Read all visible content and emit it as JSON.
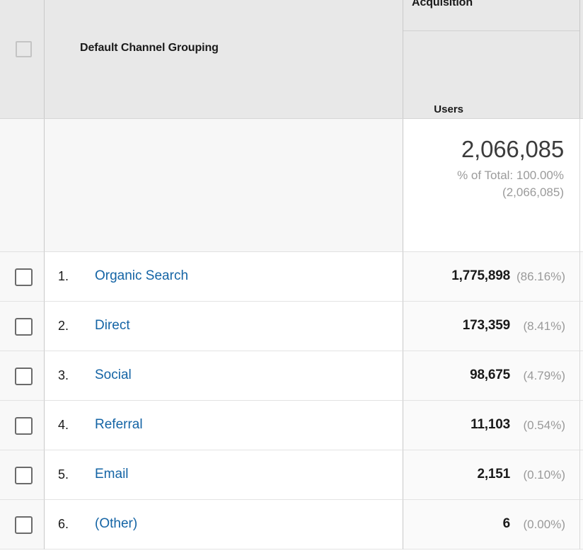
{
  "table": {
    "header": {
      "select_all_checkbox": "",
      "dimension_label": "Default Channel Grouping",
      "group_label": "Acquisition",
      "metric_label": "Users",
      "help_icon_glyph": "?",
      "sort_direction": "descending",
      "sort_arrow_glyph": "↓"
    },
    "summary": {
      "total": "2,066,085",
      "percent_of_total": "% of Total: 100.00%",
      "total_parenthetical": "(2,066,085)"
    },
    "columns": [
      "",
      "Default Channel Grouping",
      "Users"
    ],
    "rows": [
      {
        "index": "1.",
        "channel": "Organic Search",
        "users": "1,775,898",
        "percent": "(86.16%)"
      },
      {
        "index": "2.",
        "channel": "Direct",
        "users": "173,359",
        "percent": "(8.41%)"
      },
      {
        "index": "3.",
        "channel": "Social",
        "users": "98,675",
        "percent": "(4.79%)"
      },
      {
        "index": "4.",
        "channel": "Referral",
        "users": "11,103",
        "percent": "(0.54%)"
      },
      {
        "index": "5.",
        "channel": "Email",
        "users": "2,151",
        "percent": "(0.10%)"
      },
      {
        "index": "6.",
        "channel": "(Other)",
        "users": "6",
        "percent": "(0.00%)"
      }
    ]
  },
  "colors": {
    "link": "#1464a5",
    "header_bg": "#e8e8e8",
    "summary_bg": "#f7f7f7",
    "sorted_column_bg": "#fafafa",
    "muted_text": "#999999"
  }
}
